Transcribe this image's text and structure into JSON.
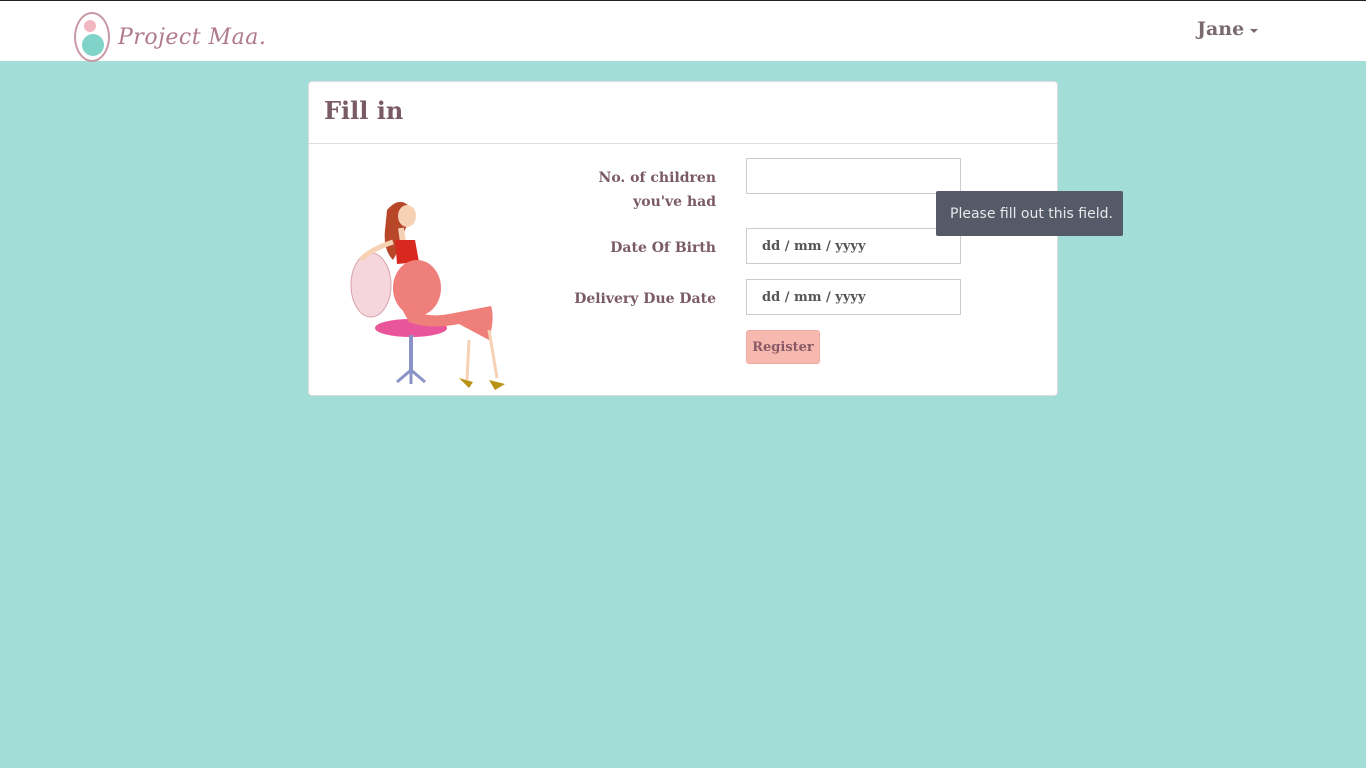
{
  "navbar": {
    "brand_text": "Project Maa.",
    "user_name": "Jane"
  },
  "panel": {
    "title": "Fill in"
  },
  "form": {
    "children_label_line1": "No. of children",
    "children_label_line2": "you've had",
    "children_value": "",
    "dob_label": "Date Of Birth",
    "dob_placeholder": "dd / mm / yyyy",
    "due_label": "Delivery Due Date",
    "due_placeholder": "dd / mm / yyyy",
    "register_label": "Register"
  },
  "tooltip": {
    "text": "Please fill out this field."
  },
  "colors": {
    "background": "#a2ddd8",
    "text": "#7a5a66",
    "button": "#f7b8b0",
    "tooltip": "#555a68"
  }
}
